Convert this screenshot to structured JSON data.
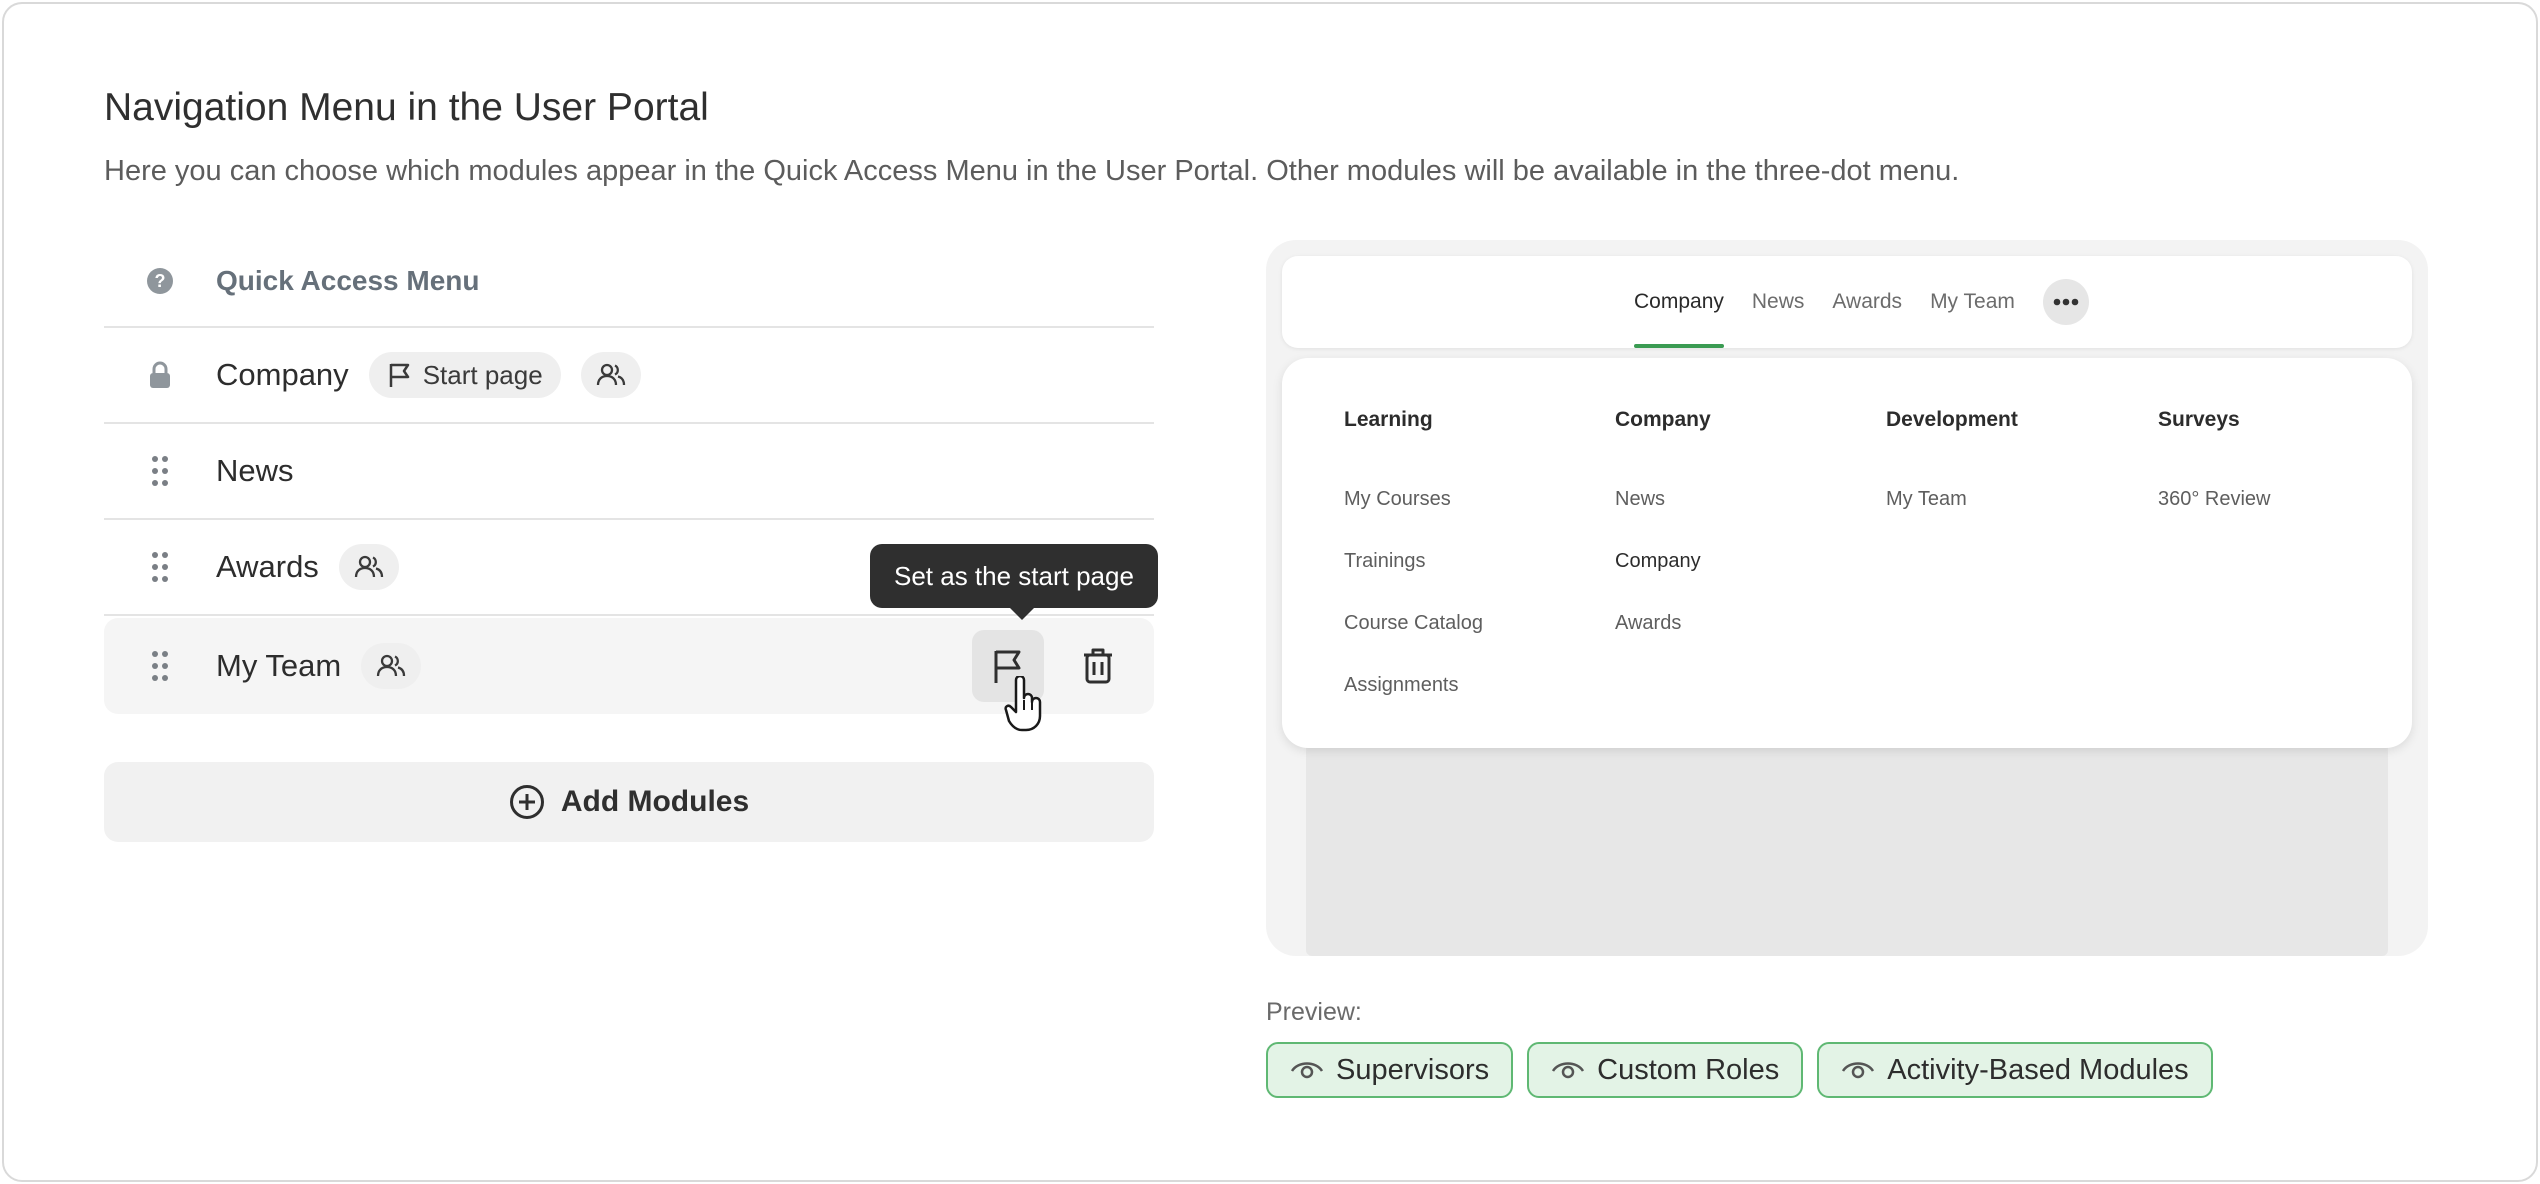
{
  "header": {
    "title": "Navigation Menu in the User Portal",
    "subtitle": "Here you can choose which modules appear in the Quick Access Menu in the User Portal. Other modules will be available in the three-dot menu."
  },
  "quick_access": {
    "header_label": "Quick Access Menu",
    "header_icon": "help-icon",
    "items": [
      {
        "name": "Company",
        "lead_icon": "lock-icon",
        "start_chip": "Start page",
        "has_group_chip": true
      },
      {
        "name": "News",
        "lead_icon": "drag-handle-icon",
        "has_group_chip": false
      },
      {
        "name": "Awards",
        "lead_icon": "drag-handle-icon",
        "has_group_chip": true
      },
      {
        "name": "My Team",
        "lead_icon": "drag-handle-icon",
        "has_group_chip": true,
        "hovered": true
      }
    ],
    "tooltip": "Set as the start page",
    "add_button": "Add Modules"
  },
  "preview": {
    "tabs": [
      "Company",
      "News",
      "Awards",
      "My Team"
    ],
    "active_tab": "Company",
    "menu_columns": [
      {
        "heading": "Learning",
        "items": [
          "My Courses",
          "Trainings",
          "Course Catalog",
          "Assignments"
        ]
      },
      {
        "heading": "Company",
        "items": [
          "News",
          "Company",
          "Awards"
        ],
        "selected": "Company"
      },
      {
        "heading": "Development",
        "items": [
          "My Team"
        ]
      },
      {
        "heading": "Surveys",
        "items": [
          "360° Review"
        ]
      }
    ],
    "label": "Preview:",
    "badges": [
      "Supervisors",
      "Custom Roles",
      "Activity-Based Modules"
    ]
  },
  "colors": {
    "accent_green": "#3a9b52",
    "badge_bg": "#e3f3e6",
    "badge_border": "#5fb873",
    "tooltip_bg": "#2f2f2f"
  }
}
